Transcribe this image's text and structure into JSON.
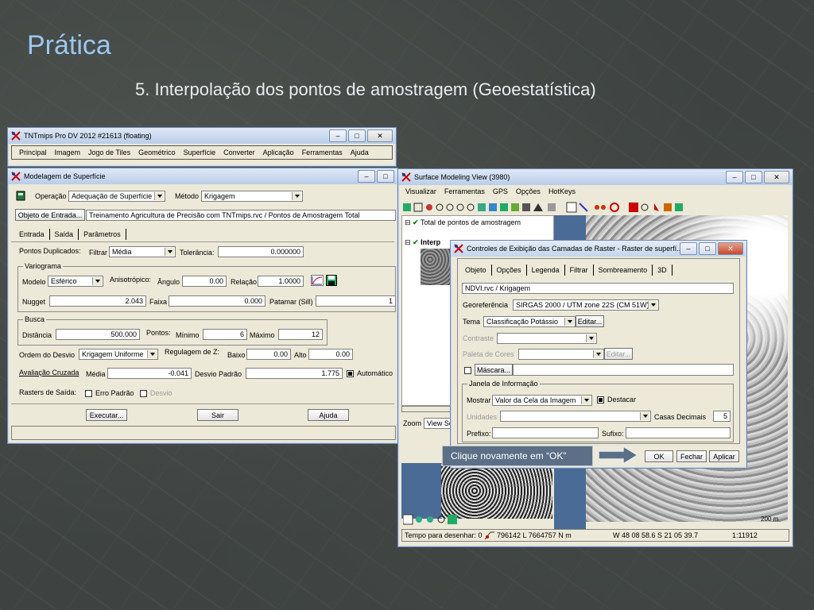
{
  "slide": {
    "title": "Prática",
    "subtitle": "5. Interpolação dos pontos de amostragem (Geoestatística)"
  },
  "main_window": {
    "title": "TNTmips Pro DV 2012  #21613 (floating)",
    "menu": [
      "Principal",
      "Imagem",
      "Jogo de Tiles",
      "Geométrico",
      "Superfície",
      "Converter",
      "Aplicação",
      "Ferramentas",
      "Ajuda"
    ]
  },
  "surface_modeling": {
    "title": "Modelagem de Superfície",
    "operacao_label": "Operação",
    "operacao_value": "Adequação de Superfície",
    "metodo_label": "Método",
    "metodo_value": "Krigagem",
    "input_button": "Objeto de Entrada...",
    "input_value": "Treinamento Agricultura de Precisão com TNTmips.rvc / Pontos de Amostragem Total",
    "tabs": [
      "Entrada",
      "Saída",
      "Parâmetros"
    ],
    "dup_label": "Pontos Duplicados:",
    "filtrar_label": "Filtrar",
    "filtrar_value": "Média",
    "tolerancia_label": "Tolerância:",
    "tolerancia_value": "0.000000",
    "variograma_label": "Variograma",
    "modelo_label": "Modelo",
    "modelo_value": "Esférico",
    "anisotropico_label": "Anisotrópico:",
    "angulo_label": "Ângulo",
    "angulo_value": "0.00",
    "relacao_label": "Relação",
    "relacao_value": "1.0000",
    "nugget_label": "Nugget",
    "nugget_value": "2.043",
    "faixa_label": "Faixa",
    "faixa_value": "0.000",
    "patamar_label": "Patamar (Sill)",
    "patamar_value": "1",
    "busca_label": "Busca",
    "distancia_label": "Distância",
    "distancia_value": "500.000",
    "pontos_label": "Pontos:",
    "minimo_label": "Mínimo",
    "minimo_value": "6",
    "maximo_label": "Máximo",
    "maximo_value": "12",
    "ordem_label": "Ordem do Desvio",
    "ordem_value": "Krigagem Uniforme",
    "regulagem_label": "Regulagem de Z:",
    "baixo_label": "Baixo",
    "baixo_value": "0.00",
    "alto_label": "Alto",
    "alto_value": "0.00",
    "avaliacao_button": "Avaliação Cruzada",
    "media_label": "Média",
    "media_value": "-0.041",
    "desvio_label": "Desvio Padrão",
    "desvio_value": "1.775",
    "automatico_label": "Automático",
    "rasters_label": "Rasters de Saída:",
    "erro_label": "Erro Padrão",
    "desvio2_label": "Desvio",
    "executar_button": "Executar...",
    "sair_button": "Sair",
    "ajuda_button": "Ajuda"
  },
  "view_window": {
    "title": "Surface Modeling View (3980)",
    "menu": [
      "Visualizar",
      "Ferramentas",
      "GPS",
      "Opções",
      "HotKeys"
    ],
    "layer1": "Total de pontos de amostragem",
    "layer2": "Interp",
    "zoom_label": "Zoom",
    "zoom_value": "View Sc",
    "status_draw": "Tempo para desenhar: 0",
    "status_coord": "796142 L  7664757 N m",
    "status_latlon": "W 48 08 58.6  S 21 05 39.7",
    "status_scale": "1:11912",
    "scalebar": "200 m"
  },
  "raster_dialog": {
    "title": "Controles de Exibição das Camadas de Raster - Raster de superfí...",
    "tabs": [
      "Objeto",
      "Opções",
      "Legenda",
      "Filtrar",
      "Sombreamento",
      "3D"
    ],
    "object_value": "NDVI.rvc / Krigagem",
    "georef_label": "Georeferência",
    "georef_value": "SIRGAS 2000 / UTM zone 22S (CM 51W)",
    "tema_label": "Tema",
    "tema_value": "Classificação Potássio",
    "editar_button": "Editar...",
    "contraste_label": "Contraste",
    "paleta_label": "Paleta de Cores",
    "editar2_button": "Editar...",
    "mascara_button": "Máscara...",
    "janela_label": "Janela de Informação",
    "mostrar_label": "Mostrar",
    "mostrar_value": "Valor da Cela da Imagem",
    "destacar_label": "Destacar",
    "unidades_label": "Unidades",
    "casas_label": "Casas Decimais",
    "casas_value": "5",
    "prefixo_label": "Prefixo:",
    "sufixo_label": "Sufixo:",
    "ok_button": "OK",
    "fechar_button": "Fechar",
    "aplicar_button": "Aplicar"
  },
  "callout": {
    "text": "Clique novamente em “OK”"
  },
  "colors": {
    "title_blue": "#9cc6f0",
    "callout_bg": "#5b6f86"
  }
}
